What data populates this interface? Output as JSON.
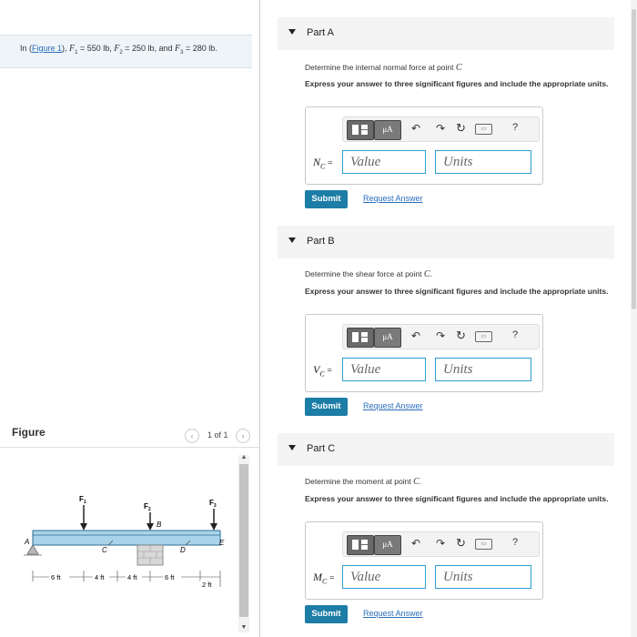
{
  "problem": {
    "prefix": "In (",
    "figure_link": "Figure 1",
    "mid1": "), ",
    "f1": "F",
    "f1_sub": "1",
    "f1_val": " = 550 lb, ",
    "f2": "F",
    "f2_sub": "2",
    "f2_val": " = 250 lb, and ",
    "f3": "F",
    "f3_sub": "3",
    "f3_val": " = 280 lb."
  },
  "figure_panel": {
    "title": "Figure",
    "pager": "1 of 1",
    "prev_icon": "‹",
    "next_icon": "›",
    "scroll_up": "▲",
    "scroll_down": "▼"
  },
  "diagram": {
    "forces": [
      "F",
      "F",
      "F"
    ],
    "force_subs": [
      "1",
      "2",
      "3"
    ],
    "points": [
      "A",
      "B",
      "C",
      "D",
      "E"
    ],
    "dims": [
      "6 ft",
      "4 ft",
      "4 ft",
      "6 ft",
      "2 ft"
    ]
  },
  "toolbar": {
    "mu": "μA",
    "undo": "↶",
    "redo": "↷",
    "reset": "↻",
    "keyboard": "▭",
    "help": "?"
  },
  "parts": [
    {
      "title": "Part A",
      "instruction_prefix": "Determine the internal normal force at point ",
      "instruction_var": "C",
      "instruction_suffix": "",
      "express": "Express your answer to three significant figures and include the appropriate units.",
      "var_label": "N",
      "var_sub": "C",
      "eq": " =",
      "value_placeholder": "Value",
      "units_placeholder": "Units",
      "submit": "Submit",
      "request": "Request Answer"
    },
    {
      "title": "Part B",
      "instruction_prefix": "Determine the shear force at point ",
      "instruction_var": "C",
      "instruction_suffix": ".",
      "express": "Express your answer to three significant figures and include the appropriate units.",
      "var_label": "V",
      "var_sub": "C",
      "eq": " =",
      "value_placeholder": "Value",
      "units_placeholder": "Units",
      "submit": "Submit",
      "request": "Request Answer"
    },
    {
      "title": "Part C",
      "instruction_prefix": "Determine the moment at point ",
      "instruction_var": "C",
      "instruction_suffix": ".",
      "express": "Express your answer to three significant figures and include the appropriate units.",
      "var_label": "M",
      "var_sub": "C",
      "eq": " =",
      "value_placeholder": "Value",
      "units_placeholder": "Units",
      "submit": "Submit",
      "request": "Request Answer"
    }
  ]
}
